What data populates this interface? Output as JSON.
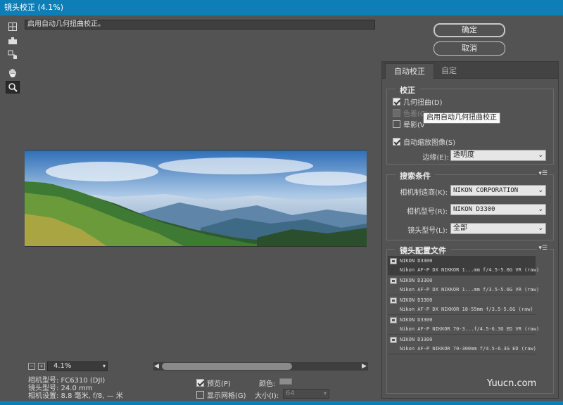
{
  "window": {
    "title": "镜头校正 (4.1%)"
  },
  "toolbar": {
    "tools": [
      {
        "name": "remove-distortion-tool-icon"
      },
      {
        "name": "straighten-tool-icon"
      },
      {
        "name": "move-grid-tool-icon"
      },
      {
        "name": "hand-tool-icon"
      },
      {
        "name": "zoom-tool-icon",
        "active": true
      }
    ]
  },
  "hint": "启用自动几何扭曲校正。",
  "preview": {
    "zoom": "4.1%"
  },
  "info": {
    "camera_model": "相机型号: FC6310 (DJI)",
    "lens_model": "镜头型号: 24.0 mm",
    "camera_settings": "相机设置: 8.8 毫米, f/8, — 米"
  },
  "options": {
    "preview_label": "预览(P)",
    "show_grid_label": "显示网格(G)",
    "color_label": "颜色:",
    "size_label": "大小(I):",
    "size_value": "64"
  },
  "buttons": {
    "ok": "确定",
    "cancel": "取消"
  },
  "tabs": {
    "auto": "自动校正",
    "custom": "自定"
  },
  "correction": {
    "title": "校正",
    "geometric": "几何扭曲(D)",
    "chromatic": "色差(C)",
    "vignette": "晕影(V",
    "auto_scale": "自动缩放图像(S)",
    "edge_label": "边缘(E):",
    "edge_value": "透明度"
  },
  "tooltip": "启用自动几何扭曲校正",
  "search": {
    "title": "搜索条件",
    "maker_label": "相机制造商(K):",
    "maker_value": "NIKON CORPORATION",
    "model_label": "相机型号(R):",
    "model_value": "NIKON D3300",
    "lens_label": "镜头型号(L):",
    "lens_value": "全部"
  },
  "profiles": {
    "title": "镜头配置文件",
    "items": [
      {
        "maker": "NIKON D3300",
        "lens": "Nikon AF-P DX NIKKOR 1...mm f/4.5-5.6G VR (raw)"
      },
      {
        "maker": "NIKON D3300",
        "lens": "Nikon AF-P DX NIKKOR 1...mm f/3.5-5.6G VR (raw)"
      },
      {
        "maker": "NIKON D3300",
        "lens": "Nikon AF-P DX NIKKOR 18-55mm f/3.5-5.6G (raw)"
      },
      {
        "maker": "NIKON D3300",
        "lens": "Nikon AF-P NIKKOR 70-3...f/4.5-6.3G ED VR (raw)"
      },
      {
        "maker": "NIKON D3300",
        "lens": "Nikon AF-P NIKKOR 70-300mm f/4.5-6.3G ED (raw)"
      }
    ]
  },
  "watermark": "Yuucn.com"
}
